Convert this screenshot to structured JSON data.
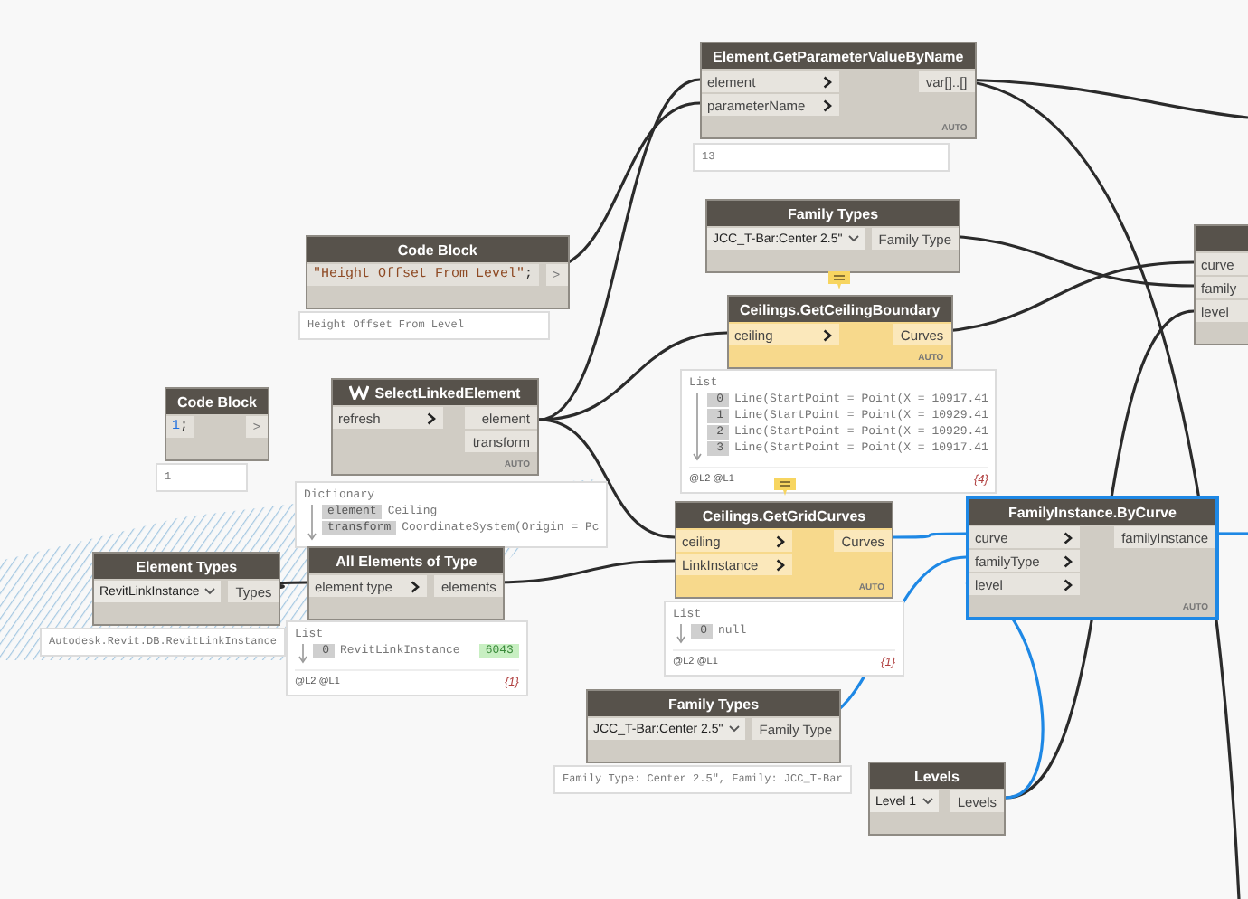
{
  "canvas": {
    "nodes": [
      {
        "kind": "function",
        "title": "Element.GetParameterValueByName",
        "warning": false,
        "selected": false,
        "inputs": [
          "element",
          "parameterName"
        ],
        "outputs": [
          "var[]..[]"
        ],
        "lacing": "AUTO",
        "preview": {
          "kind": "text",
          "text": "13"
        }
      },
      {
        "kind": "dropdown",
        "title": "Family Types",
        "warning": false,
        "selected": false,
        "value": "JCC_T-Bar:Center 2.5\"",
        "outputs": [
          "Family Type"
        ]
      },
      {
        "kind": "function",
        "title": "Ceilings.GetCeilingBoundary",
        "warning": true,
        "selected": false,
        "inputs": [
          "ceiling"
        ],
        "outputs": [
          "Curves"
        ],
        "lacing": "AUTO",
        "preview": {
          "kind": "list",
          "header": "List",
          "items": [
            {
              "index": "0",
              "value": "Line(StartPoint = Point(X = 10917.41"
            },
            {
              "index": "1",
              "value": "Line(StartPoint = Point(X = 10929.41"
            },
            {
              "index": "2",
              "value": "Line(StartPoint = Point(X = 10929.41"
            },
            {
              "index": "3",
              "value": "Line(StartPoint = Point(X = 10917.41"
            }
          ],
          "levels": "@L2 @L1",
          "count": "{4}"
        }
      },
      {
        "kind": "code",
        "title": "Code Block",
        "warning": false,
        "selected": false,
        "tokens": [
          {
            "kind": "string",
            "text": "\"Height Offset From Level\""
          },
          {
            "kind": "plain",
            "text": ";"
          }
        ],
        "outputs": [
          ">"
        ],
        "preview": {
          "kind": "text",
          "text": "Height Offset From Level"
        }
      },
      {
        "kind": "code",
        "title": "Code Block",
        "warning": false,
        "selected": false,
        "tokens": [
          {
            "kind": "number",
            "text": "1"
          },
          {
            "kind": "plain",
            "text": ";"
          }
        ],
        "outputs": [
          ">"
        ],
        "preview": {
          "kind": "text",
          "text": "1"
        }
      },
      {
        "kind": "function",
        "title": "SelectLinkedElement",
        "package_icon": true,
        "warning": false,
        "selected": false,
        "inputs": [
          "refresh"
        ],
        "outputs": [
          "element",
          "transform"
        ],
        "lacing": "AUTO",
        "preview": {
          "kind": "dictionary",
          "header": "Dictionary",
          "items": [
            {
              "key": "element",
              "value": "Ceiling"
            },
            {
              "key": "transform",
              "value": "CoordinateSystem(Origin = Pc"
            }
          ]
        }
      },
      {
        "kind": "dropdown",
        "title": "Element Types",
        "warning": false,
        "selected": false,
        "value": "RevitLinkInstance",
        "outputs": [
          "Types"
        ],
        "preview": {
          "kind": "text",
          "text": "Autodesk.Revit.DB.RevitLinkInstance"
        }
      },
      {
        "kind": "function",
        "title": "All Elements of Type",
        "warning": false,
        "selected": false,
        "inputs": [
          "element type"
        ],
        "outputs": [
          "elements"
        ],
        "preview": {
          "kind": "list",
          "header": "List",
          "items": [
            {
              "index": "0",
              "value": "RevitLinkInstance",
              "id": "6043"
            }
          ],
          "levels": "@L2 @L1",
          "count": "{1}"
        }
      },
      {
        "kind": "function",
        "title": "Ceilings.GetGridCurves",
        "warning": true,
        "selected": false,
        "inputs": [
          "ceiling",
          "LinkInstance"
        ],
        "outputs": [
          "Curves"
        ],
        "lacing": "AUTO",
        "preview": {
          "kind": "list",
          "header": "List",
          "items": [
            {
              "index": "0",
              "value": "null"
            }
          ],
          "levels": "@L2 @L1",
          "count": "{1}"
        }
      },
      {
        "kind": "function",
        "title": "FamilyInstance.ByCurve",
        "warning": false,
        "selected": true,
        "inputs": [
          "curve",
          "familyType",
          "level"
        ],
        "outputs": [
          "familyInstance"
        ],
        "lacing": "AUTO"
      },
      {
        "kind": "dropdown",
        "title": "Family Types",
        "warning": false,
        "selected": false,
        "value": "JCC_T-Bar:Center 2.5\"",
        "outputs": [
          "Family Type"
        ],
        "preview": {
          "kind": "text",
          "text": "Family Type: Center 2.5\", Family: JCC_T-Bar"
        }
      },
      {
        "kind": "dropdown",
        "title": "Levels",
        "warning": false,
        "selected": false,
        "value": "Level 1",
        "outputs": [
          "Levels"
        ]
      },
      {
        "kind": "function",
        "warning": false,
        "selected": false,
        "inputs": [
          "curve",
          "family",
          "level"
        ]
      }
    ]
  }
}
